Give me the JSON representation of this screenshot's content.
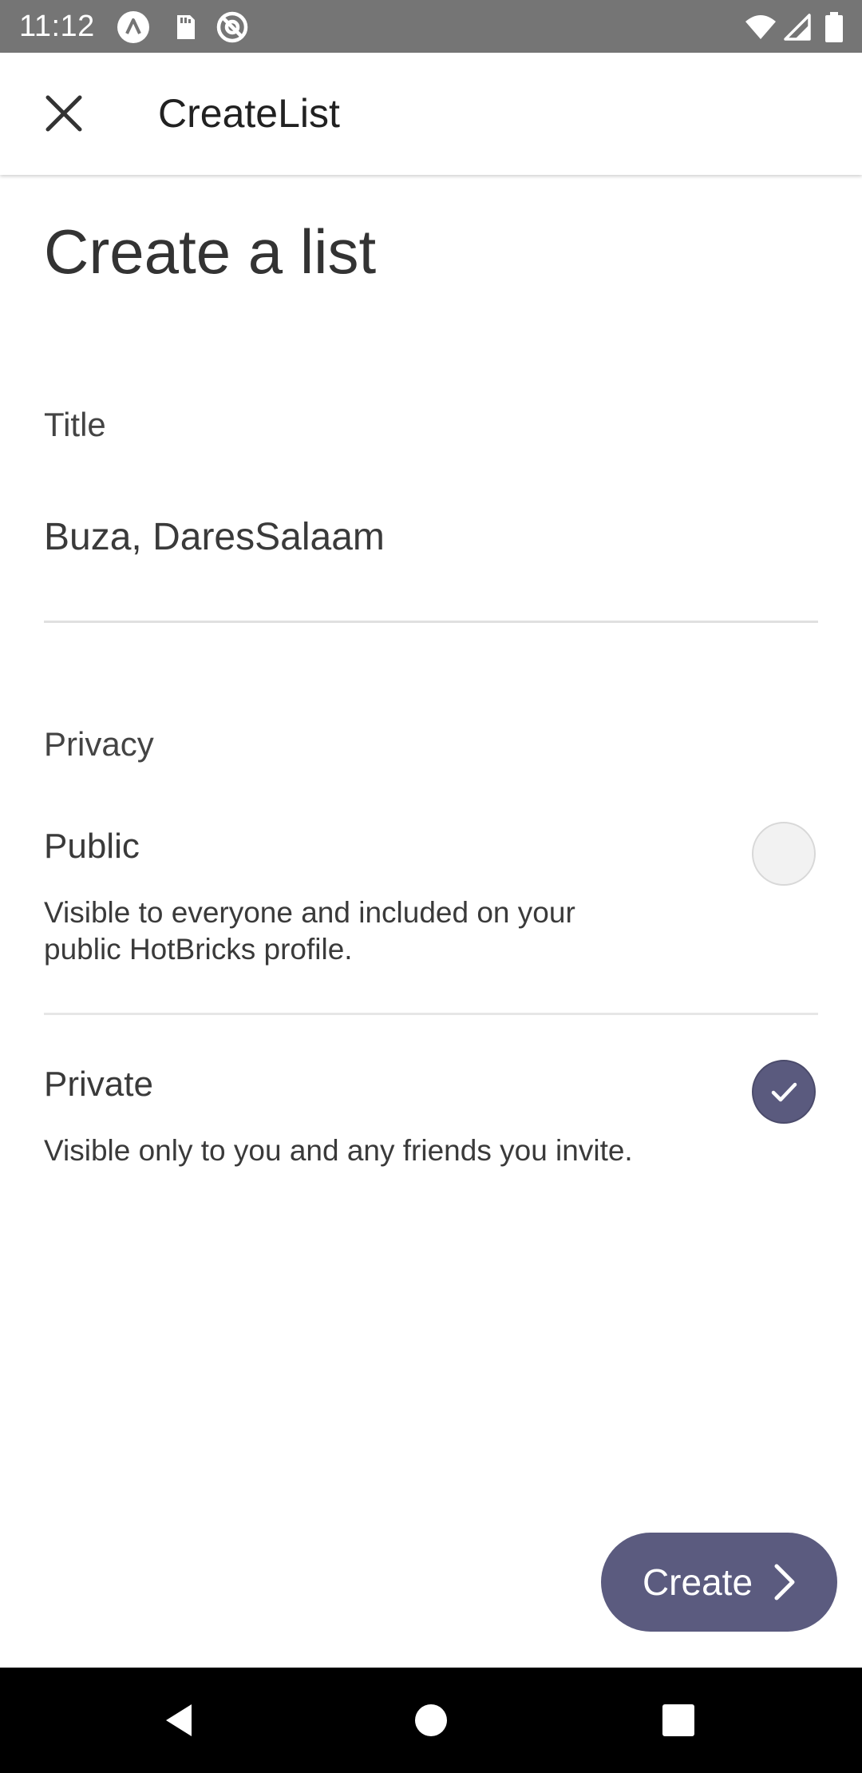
{
  "status_bar": {
    "time": "11:12",
    "left_icons": [
      "app-a-icon",
      "sd-card-icon",
      "at-sign-icon"
    ],
    "right_icons": [
      "wifi-icon",
      "cell-signal-icon",
      "battery-icon"
    ]
  },
  "app_bar": {
    "title": "CreateList",
    "close_icon": "close-icon"
  },
  "page": {
    "heading": "Create a list"
  },
  "title_field": {
    "label": "Title",
    "value": "Buza, DaresSalaam"
  },
  "privacy": {
    "label": "Privacy",
    "options": [
      {
        "title": "Public",
        "description": "Visible to everyone and included on your public HotBricks profile.",
        "selected": false
      },
      {
        "title": "Private",
        "description": "Visible only to you and any friends you invite.",
        "selected": true
      }
    ]
  },
  "create_button": {
    "label": "Create",
    "icon": "chevron-right-icon"
  },
  "nav_bar": {
    "icons": [
      "back-icon",
      "home-icon",
      "recents-icon"
    ]
  },
  "colors": {
    "accent": "#5b5b7f",
    "status_bar": "#757575",
    "nav_bar": "#000000"
  }
}
